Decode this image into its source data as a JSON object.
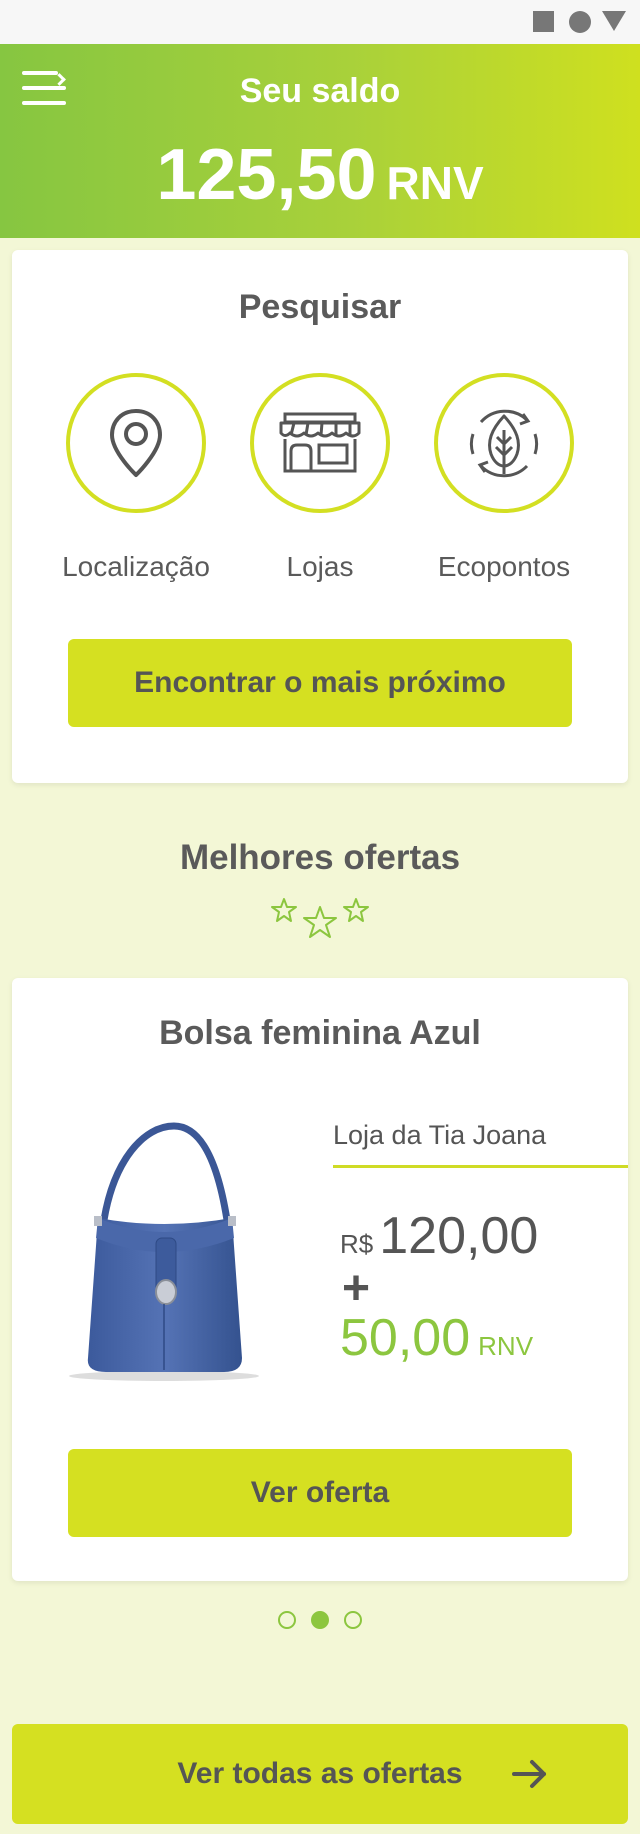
{
  "header": {
    "balance_label": "Seu saldo",
    "balance_value": "125,50",
    "balance_unit": "RNV"
  },
  "search": {
    "title": "Pesquisar",
    "categories": [
      {
        "label": "Localização",
        "icon": "map-pin-icon"
      },
      {
        "label": "Lojas",
        "icon": "store-icon"
      },
      {
        "label": "Ecopontos",
        "icon": "eco-leaf-icon"
      }
    ],
    "find_button": "Encontrar o mais próximo"
  },
  "offers": {
    "title": "Melhores ofertas",
    "product_name": "Bolsa feminina Azul",
    "store": "Loja da Tia Joana",
    "price_currency": "R$",
    "price_value": "120,00",
    "plus": "+",
    "rnv_value": "50,00",
    "rnv_unit": "RNV",
    "view_button": "Ver oferta",
    "carousel_pages": 3,
    "carousel_active": 2
  },
  "footer": {
    "all_offers_button": "Ver todas as ofertas"
  },
  "colors": {
    "accent": "#d5e021",
    "green": "#8cc63f",
    "header_gradient_start": "#86c641",
    "header_gradient_end": "#cfe01f",
    "background": "#f3f7d6"
  }
}
